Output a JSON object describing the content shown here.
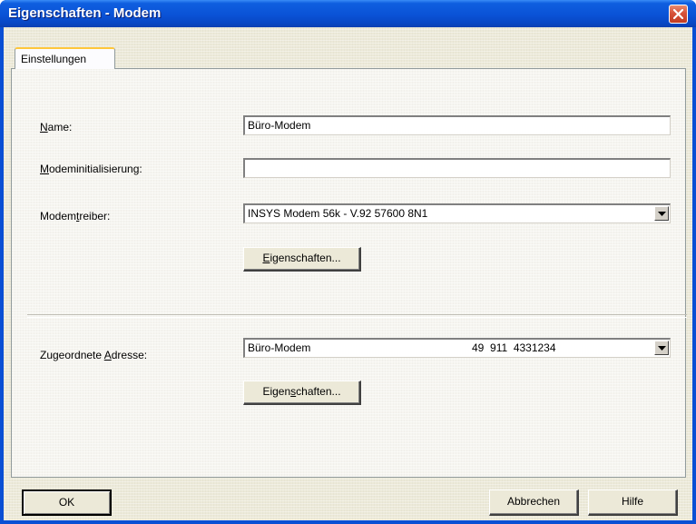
{
  "window": {
    "title": "Eigenschaften - Modem"
  },
  "tabs": [
    {
      "label": "Einstellungen",
      "selected": true
    }
  ],
  "form": {
    "name": {
      "label": "Name:",
      "mnemonic": "N",
      "value": "Büro-Modem"
    },
    "init": {
      "label": "Modeminitialisierung:",
      "mnemonic": "M",
      "value": ""
    },
    "treiber": {
      "label": "Modemtreiber:",
      "mnemonic": "t",
      "value": "INSYS Modem 56k - V.92 57600 8N1"
    },
    "treiber_button": {
      "label": "Eigenschaften...",
      "mnemonic": "E"
    },
    "adresse": {
      "label": "Zugeordnete Adresse:",
      "mnemonic": "A",
      "value_name": "Büro-Modem",
      "value_number": "49  911  4331234"
    },
    "adresse_button": {
      "label": "Eigenschaften...",
      "mnemonic": "s"
    }
  },
  "buttons": {
    "ok": "OK",
    "cancel": "Abbrechen",
    "help": "Hilfe"
  },
  "colors": {
    "titlebar": "#0a52d6",
    "face": "#ece9d8",
    "tab_accent": "#ffc73c",
    "close": "#d7523a"
  }
}
